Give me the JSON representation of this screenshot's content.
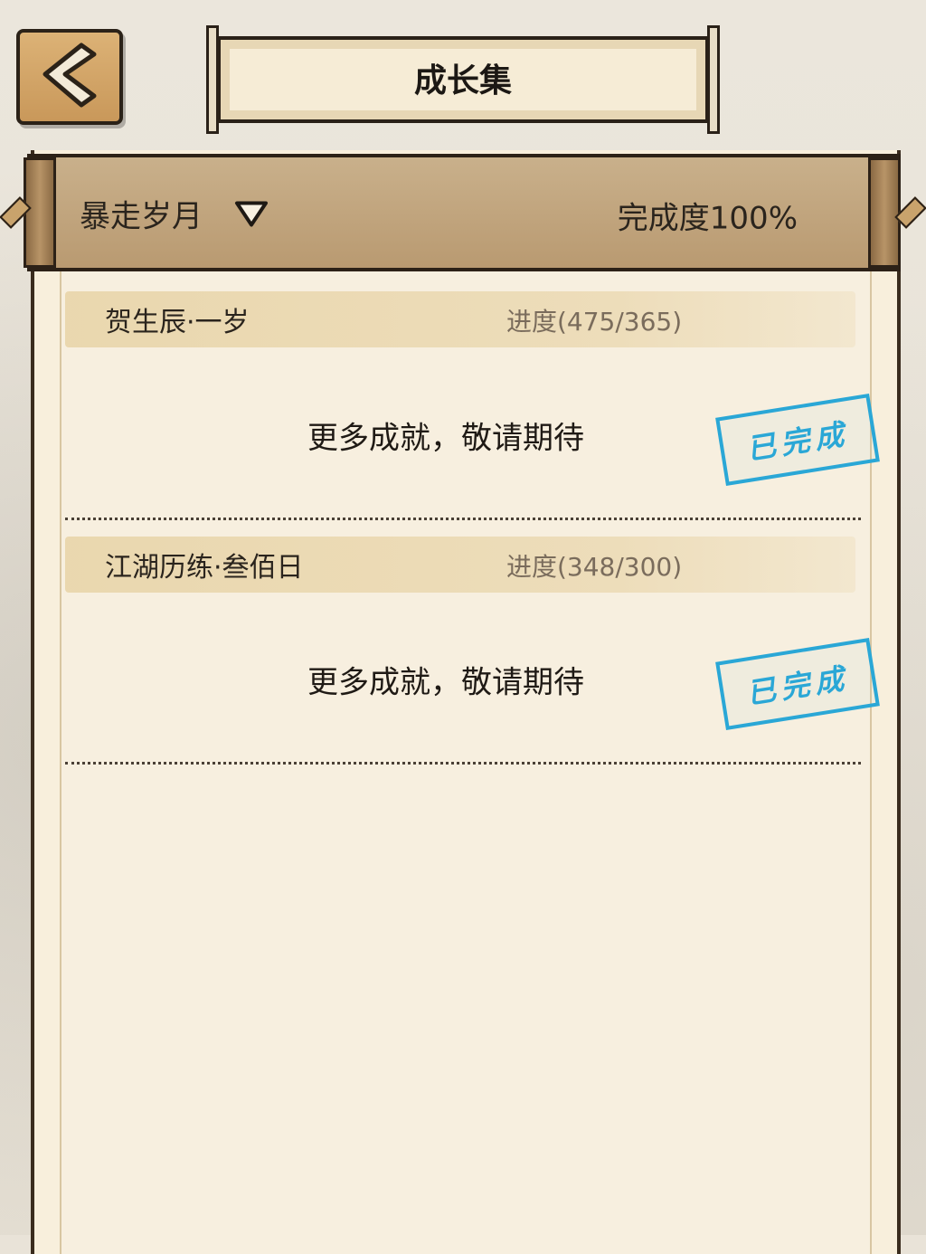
{
  "header": {
    "title": "成长集",
    "back_icon": "chevron-left-icon"
  },
  "category_bar": {
    "selected": "暴走岁月",
    "dropdown_icon": "triangle-down-icon",
    "completion": "完成度100%"
  },
  "achievements": [
    {
      "name": "贺生辰·一岁",
      "progress": "进度(475/365)",
      "message": "更多成就，敬请期待",
      "stamp": "已完成"
    },
    {
      "name": "江湖历练·叁佰日",
      "progress": "进度(348/300)",
      "message": "更多成就，敬请期待",
      "stamp": "已完成"
    }
  ],
  "colors": {
    "stamp": "#2aa7d6",
    "parchment": "#f8efdc",
    "header_bar": "#c9b08b",
    "back_button": "#d6a96b"
  }
}
